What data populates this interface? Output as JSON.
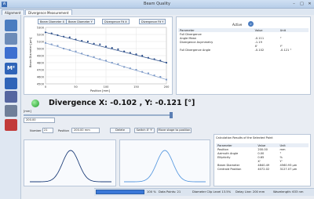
{
  "window": {
    "title": "Beam Quality",
    "min": "–",
    "max": "□",
    "close": "✕"
  },
  "tabs": [
    "Alignment",
    "Divergence Measurement"
  ],
  "legend": [
    "Beam Diameter X",
    "Beam Diameter Y",
    "Divergence Fit X",
    "Divergence Fit Y"
  ],
  "chart_data": {
    "type": "scatter",
    "ylabel": "Beam Diameter [µm]",
    "xlabel": "Position [mm]",
    "xlim": [
      0,
      200
    ],
    "ylim": [
      4500,
      5300
    ],
    "xticks": [
      0,
      50,
      100,
      150,
      200
    ],
    "yticks": [
      4500,
      4600,
      4700,
      4800,
      4900,
      5000,
      5100,
      5200,
      5300
    ],
    "series": [
      {
        "name": "Beam Diameter X",
        "x": [
          0,
          10,
          20,
          30,
          40,
          50,
          60,
          70,
          80,
          90,
          100,
          110,
          120,
          130,
          140,
          150,
          160,
          170,
          180,
          190,
          200
        ],
        "y": [
          5230,
          5215,
          5190,
          5170,
          5160,
          5130,
          5110,
          5100,
          5070,
          5060,
          5030,
          5010,
          4990,
          4960,
          4940,
          4920,
          4900,
          4870,
          4850,
          4830,
          4800
        ]
      },
      {
        "name": "Beam Diameter Y",
        "x": [
          0,
          10,
          20,
          30,
          40,
          50,
          60,
          70,
          80,
          90,
          100,
          110,
          120,
          130,
          140,
          150,
          160,
          170,
          180,
          190,
          200
        ],
        "y": [
          5080,
          5060,
          5040,
          5000,
          4980,
          4960,
          4930,
          4900,
          4880,
          4850,
          4830,
          4800,
          4780,
          4740,
          4720,
          4700,
          4670,
          4650,
          4620,
          4600,
          4560
        ]
      }
    ]
  },
  "active": {
    "label": "Active"
  },
  "param_table": {
    "headers": [
      "Parameter",
      "Value",
      "Unit"
    ],
    "rows": [
      [
        "Full Divergence",
        "",
        ""
      ],
      [
        "Angle Mean",
        "-0.111",
        "°"
      ],
      [
        "Divergence Asymmetry",
        "-1.19",
        ""
      ],
      [
        "",
        "X'",
        "Y'"
      ],
      [
        "Full Divergence Angle",
        "-0.102",
        "-0.121 °"
      ]
    ]
  },
  "divergence": "Divergence X: -0.102 , Y: -0.121 [°]",
  "slider": {
    "unit": "[mm]",
    "value": "200.00"
  },
  "controls": {
    "number_label": "Number",
    "number": "21",
    "position_label": "Position",
    "position": "200.00 mm",
    "delete": "Delete",
    "switch": "Switch X' Y'",
    "move": "Move stage to position"
  },
  "results": {
    "title": "Calculation Results of the Selected Point",
    "headers": [
      "Parameter",
      "Value",
      "Unit"
    ],
    "rows": [
      [
        "Position",
        "200.00",
        "mm"
      ],
      [
        "Azimuth Angle",
        "0.00",
        "°"
      ],
      [
        "Ellipticity",
        "0.65",
        "%"
      ],
      [
        "",
        "X'",
        "Y'"
      ],
      [
        "Beam Diameter",
        "4840.49",
        "4560.93 µm"
      ],
      [
        "Centroid Position",
        "4072.02",
        "3127.07 µm"
      ]
    ]
  },
  "status": {
    "progress": "100 %",
    "points": "Data Points: 21",
    "clip": "Diameter Clip Level 13.5%",
    "delay": "Delay Line: 200 mm",
    "wavelength": "Wavelength: 633 nm"
  }
}
